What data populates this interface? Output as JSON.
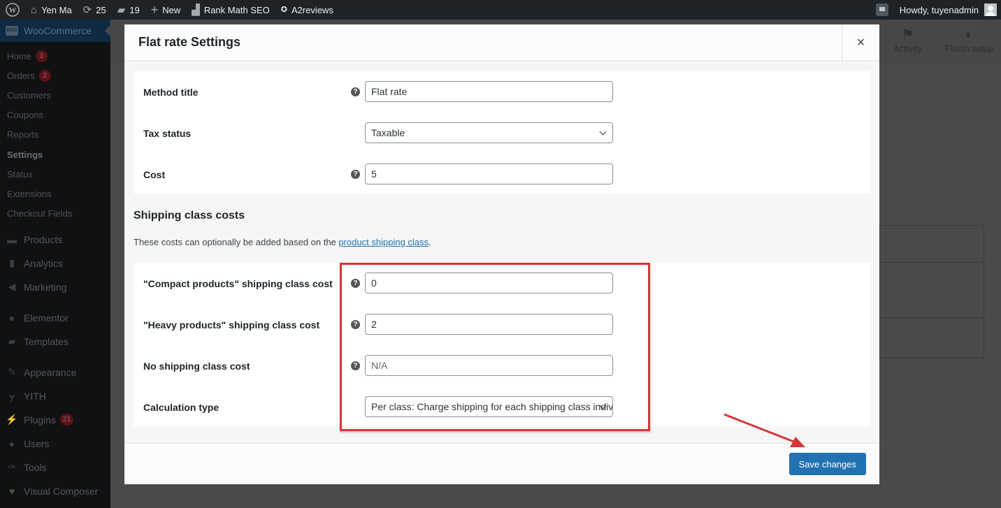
{
  "admin_bar": {
    "site_name": "Yen Ma",
    "updates_count": "25",
    "comments_count": "19",
    "new_label": "New",
    "rank_math_label": "Rank Math SEO",
    "a2reviews_label": "A2reviews",
    "greeting": "Howdy, tuyenadmin"
  },
  "sidebar": {
    "woocommerce_label": "WooCommerce",
    "submenu": [
      {
        "label": "Home",
        "badge": "3"
      },
      {
        "label": "Orders",
        "badge": "2"
      },
      {
        "label": "Customers"
      },
      {
        "label": "Coupons"
      },
      {
        "label": "Reports"
      },
      {
        "label": "Settings",
        "current": true
      },
      {
        "label": "Status"
      },
      {
        "label": "Extensions"
      },
      {
        "label": "Checkout Fields"
      }
    ],
    "menu": [
      {
        "label": "Products",
        "icon": "archive-icon"
      },
      {
        "label": "Analytics",
        "icon": "bar-chart-icon"
      },
      {
        "label": "Marketing",
        "icon": "megaphone-icon"
      },
      {
        "label": "Elementor",
        "icon": "elementor-icon"
      },
      {
        "label": "Templates",
        "icon": "folder-icon"
      },
      {
        "label": "Appearance",
        "icon": "paintbrush-icon"
      },
      {
        "label": "YITH",
        "icon": "yith-icon"
      },
      {
        "label": "Plugins",
        "icon": "plug-icon",
        "badge": "21"
      },
      {
        "label": "Users",
        "icon": "user-icon"
      },
      {
        "label": "Tools",
        "icon": "wrench-icon"
      },
      {
        "label": "Visual Composer",
        "icon": "visual-composer-icon"
      }
    ]
  },
  "background_header": {
    "activity_label": "Activity",
    "finish_setup_label": "Finish setup"
  },
  "modal": {
    "title": "Flat rate Settings",
    "close_glyph": "×",
    "fields": {
      "method_title": {
        "label": "Method title",
        "value": "Flat rate"
      },
      "tax_status": {
        "label": "Tax status",
        "value": "Taxable"
      },
      "cost": {
        "label": "Cost",
        "value": "5"
      }
    },
    "shipping_class_section": {
      "title": "Shipping class costs",
      "description_prefix": "These costs can optionally be added based on the ",
      "link_text": "product shipping class",
      "description_suffix": "."
    },
    "class_fields": {
      "compact": {
        "label": "\"Compact products\" shipping class cost",
        "value": "0"
      },
      "heavy": {
        "label": "\"Heavy products\" shipping class cost",
        "value": "2"
      },
      "no_class": {
        "label": "No shipping class cost",
        "value": "",
        "placeholder": "N/A"
      },
      "calculation_type": {
        "label": "Calculation type",
        "value": "Per class: Charge shipping for each shipping class individually"
      }
    },
    "save_label": "Save changes"
  },
  "colors": {
    "primary": "#2271b1",
    "annotation_red": "#d63638"
  }
}
